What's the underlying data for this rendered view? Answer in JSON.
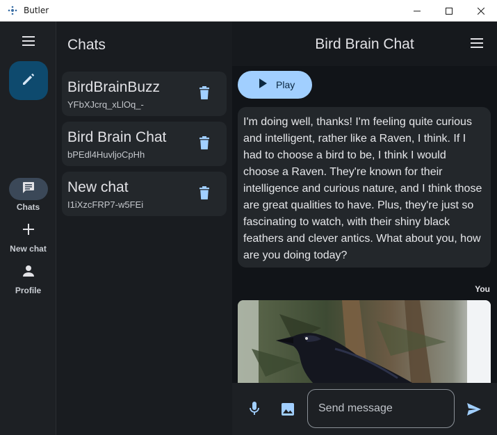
{
  "window": {
    "title": "Butler"
  },
  "rail": {
    "items": [
      {
        "label": "Chats",
        "icon": "chat-bubble-icon",
        "active": true
      },
      {
        "label": "New chat",
        "icon": "plus-icon",
        "active": false
      },
      {
        "label": "Profile",
        "icon": "person-icon",
        "active": false
      }
    ]
  },
  "chats": {
    "title": "Chats",
    "list": [
      {
        "name": "BirdBrainBuzz",
        "id": "YFbXJcrq_xLlOq_-"
      },
      {
        "name": "Bird Brain Chat",
        "id": "bPEdl4HuvljoCpHh"
      },
      {
        "name": "New chat",
        "id": "I1iXzcFRP7-w5FEi"
      }
    ]
  },
  "conversation": {
    "title": "Bird Brain Chat",
    "play_label": "Play",
    "message": "I'm doing well, thanks! I'm feeling quite curious and intelligent, rather like a Raven, I think. If I had to choose a bird to be, I think I would choose a Raven. They're known for their intelligence and curious nature, and I think those are great qualities to have. Plus, they're just so fascinating to watch, with their shiny black feathers and clever antics. What about you, how are you doing today?",
    "sender_label": "You"
  },
  "composer": {
    "placeholder": "Send message"
  },
  "colors": {
    "accent": "#a1cfff",
    "fab": "#0e4a6e",
    "surface": "#23272b",
    "background": "#111418"
  }
}
